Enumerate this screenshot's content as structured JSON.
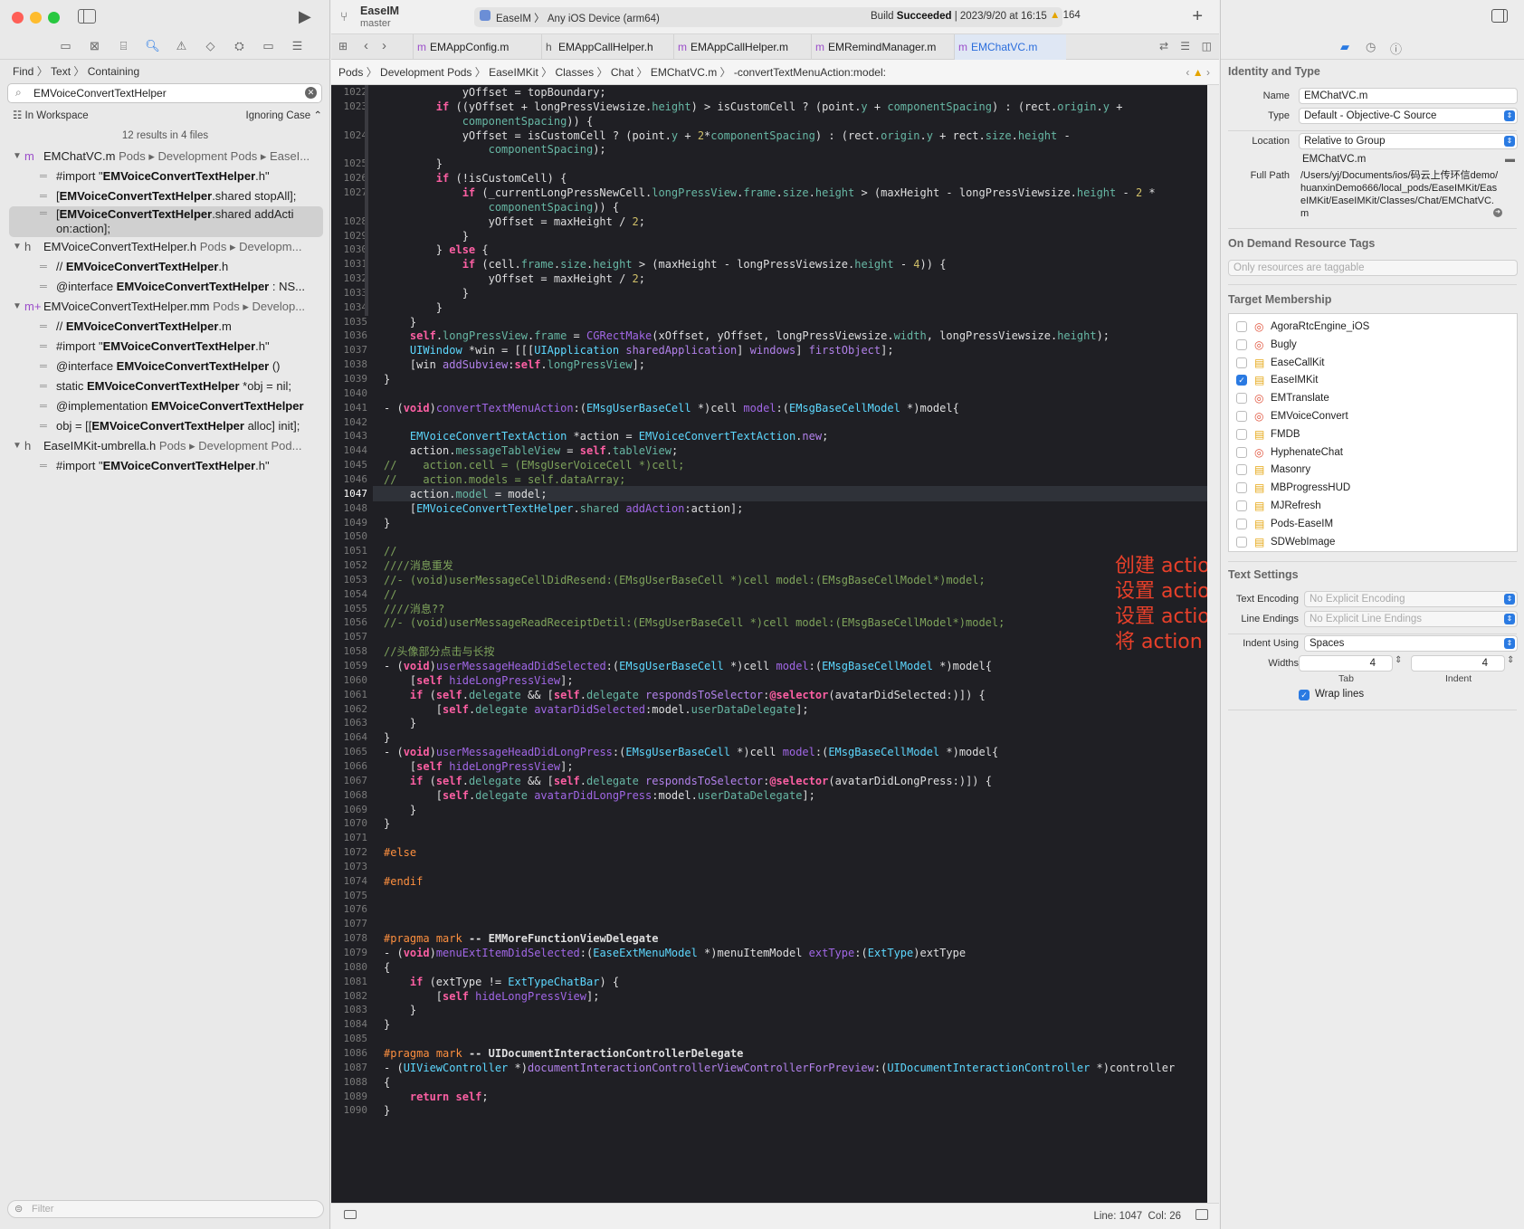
{
  "window": {
    "scheme": "EaseIM",
    "branch": "master",
    "run_destination": "EaseIM 〉 Any iOS Device (arm64)",
    "build_status_prefix": "Build ",
    "build_status": "Succeeded",
    "build_time": " | 2023/9/20 at 16:15",
    "warnings": "164",
    "colors": {
      "close": "#ff5f57",
      "minimize": "#febc2e",
      "zoom": "#28c840",
      "accent": "#2a7ae2"
    }
  },
  "navigator": {
    "find_mode": [
      "Find",
      "〉",
      "Text",
      "〉",
      "Containing"
    ],
    "search_query": "EMVoiceConvertTextHelper",
    "scope": "In Workspace",
    "case_mode": "Ignoring Case",
    "result_count": "12 results in 4 files",
    "files": [
      {
        "icon": "m",
        "name": "EMChatVC.m",
        "path": " Pods ▸ Development Pods ▸ EaseI...",
        "matches": [
          {
            "pre": "#import \"",
            "bold": "EMVoiceConvertTextHelper",
            "post": ".h\""
          },
          {
            "pre": "[",
            "bold": "EMVoiceConvertTextHelper",
            "post": ".shared stopAll];"
          },
          {
            "pre": "[",
            "bold": "EMVoiceConvertTextHelper",
            "post": ".shared addActi on:action];"
          }
        ]
      },
      {
        "icon": "h",
        "name": "EMVoiceConvertTextHelper.h",
        "path": " Pods ▸ Developm...",
        "matches": [
          {
            "pre": "//  ",
            "bold": "EMVoiceConvertTextHelper",
            "post": ".h"
          },
          {
            "pre": "@interface ",
            "bold": "EMVoiceConvertTextHelper",
            "post": " : NS..."
          }
        ]
      },
      {
        "icon": "m+",
        "name": "EMVoiceConvertTextHelper.mm",
        "path": " Pods ▸ Develop...",
        "matches": [
          {
            "pre": "//  ",
            "bold": "EMVoiceConvertTextHelper",
            "post": ".m"
          },
          {
            "pre": "#import \"",
            "bold": "EMVoiceConvertTextHelper",
            "post": ".h\""
          },
          {
            "pre": "@interface ",
            "bold": "EMVoiceConvertTextHelper",
            "post": " ()"
          },
          {
            "pre": "static ",
            "bold": "EMVoiceConvertTextHelper",
            "post": " *obj = nil;"
          },
          {
            "pre": "@implementation ",
            "bold": "EMVoiceConvertTextHelper",
            "post": ""
          },
          {
            "pre": "obj = [[",
            "bold": "EMVoiceConvertTextHelper",
            "post": " alloc] init];"
          }
        ]
      },
      {
        "icon": "h",
        "name": "EaseIMKit-umbrella.h",
        "path": " Pods ▸ Development Pod...",
        "matches": [
          {
            "pre": "#import \"",
            "bold": "EMVoiceConvertTextHelper",
            "post": ".h\""
          }
        ]
      }
    ],
    "filter_placeholder": "Filter"
  },
  "tabs": [
    "EMAppConfig.m",
    "EMAppCallHelper.h",
    "EMAppCallHelper.m",
    "EMRemindManager.m",
    "EMChatVC.m"
  ],
  "tab_icons": [
    "m",
    "h",
    "m",
    "m",
    "m"
  ],
  "jumpbar": [
    "Pods",
    "Development Pods",
    "EaseIMKit",
    "Classes",
    "Chat",
    "EMChatVC.m",
    "-convertTextMenuAction:model:"
  ],
  "editor": {
    "current_line": "1047",
    "lines": [
      {
        "n": "1022",
        "h": "            yOffset = topBoundary;"
      },
      {
        "n": "1023",
        "h": "        <k>if</k> ((yOffset + longPressViewsize.<p>height</p>) > isCustomCell ? (point.<p>y</p> + <p>componentSpacing</p>) : (rect.<p>origin</p>.<p>y</p> +"
      },
      {
        "n": "",
        "h": "            <p>componentSpacing</p>)) {"
      },
      {
        "n": "1024",
        "h": "            yOffset = isCustomCell ? (point.<p>y</p> + <u>2</u>*<p>componentSpacing</p>) : (rect.<p>origin</p>.<p>y</p> + rect.<p>size</p>.<p>height</p> -"
      },
      {
        "n": "",
        "h": "                <p>componentSpacing</p>);"
      },
      {
        "n": "1025",
        "h": "        }"
      },
      {
        "n": "1026",
        "h": "        <k>if</k> (!isCustomCell) {"
      },
      {
        "n": "1027",
        "h": "            <k>if</k> (_currentLongPressNewCell.<p>longPressView</p>.<p>frame</p>.<p>size</p>.<p>height</p> > (maxHeight - longPressViewsize.<p>height</p> - <u>2</u> *"
      },
      {
        "n": "",
        "h": "                <p>componentSpacing</p>)) {"
      },
      {
        "n": "1028",
        "h": "                yOffset = maxHeight / <u>2</u>;"
      },
      {
        "n": "1029",
        "h": "            }"
      },
      {
        "n": "1030",
        "h": "        } <k>else</k> {"
      },
      {
        "n": "1031",
        "h": "            <k>if</k> (cell.<p>frame</p>.<p>size</p>.<p>height</p> > (maxHeight - longPressViewsize.<p>height</p> - <u>4</u>)) {"
      },
      {
        "n": "1032",
        "h": "                yOffset = maxHeight / <u>2</u>;"
      },
      {
        "n": "1033",
        "h": "            }"
      },
      {
        "n": "1034",
        "h": "        }"
      },
      {
        "n": "1035",
        "h": "    }"
      },
      {
        "n": "1036",
        "h": "    <k>self</k>.<p>longPressView</p>.<p>frame</p> = <f>CGRectMake</f>(xOffset, yOffset, longPressViewsize.<p>width</p>, longPressViewsize.<p>height</p>);"
      },
      {
        "n": "1037",
        "h": "    <t>UIWindow</t> *win = [[[<t>UIApplication</t> <e>sharedApplication</e>] <e>windows</e>] <e>firstObject</e>];"
      },
      {
        "n": "1038",
        "h": "    [win <e>addSubview</e>:<k>self</k>.<p>longPressView</p>];"
      },
      {
        "n": "1039",
        "h": "}"
      },
      {
        "n": "1040",
        "h": ""
      },
      {
        "n": "1041",
        "h": "- (<k>void</k>)<f>convertTextMenuAction</f>:(<t>EMsgUserBaseCell</t> *)cell <f>model</f>:(<t>EMsgBaseCellModel</t> *)model{"
      },
      {
        "n": "1042",
        "h": ""
      },
      {
        "n": "1043",
        "h": "    <t>EMVoiceConvertTextAction</t> *action = <t>EMVoiceConvertTextAction</t>.<e>new</e>;"
      },
      {
        "n": "1044",
        "h": "    action.<p>messageTableView</p> = <k>self</k>.<p>tableView</p>;"
      },
      {
        "n": "1045",
        "h": "<c>//    action.cell = (EMsgUserVoiceCell *)cell;</c>"
      },
      {
        "n": "1046",
        "h": "<c>//    action.models = self.dataArray;</c>"
      },
      {
        "n": "1047",
        "h": "    action.<p>model</p> = model;"
      },
      {
        "n": "1048",
        "h": "    [<t>EMVoiceConvertTextHelper</t>.<p>shared</p> <f>addAction</f>:action];"
      },
      {
        "n": "1049",
        "h": "}"
      },
      {
        "n": "1050",
        "h": ""
      },
      {
        "n": "1051",
        "h": "<c>//</c>"
      },
      {
        "n": "1052",
        "h": "<c>////消息重发</c>"
      },
      {
        "n": "1053",
        "h": "<c>//- (void)userMessageCellDidResend:(EMsgUserBaseCell *)cell model:(EMsgBaseCellModel*)model;</c>"
      },
      {
        "n": "1054",
        "h": "<c>//</c>"
      },
      {
        "n": "1055",
        "h": "<c>////消息??</c>"
      },
      {
        "n": "1056",
        "h": "<c>//- (void)userMessageReadReceiptDetil:(EMsgUserBaseCell *)cell model:(EMsgBaseCellModel*)model;</c>"
      },
      {
        "n": "1057",
        "h": ""
      },
      {
        "n": "1058",
        "h": "<c>//头像部分点击与长按</c>"
      },
      {
        "n": "1059",
        "h": "- (<k>void</k>)<f>userMessageHeadDidSelected</f>:(<t>EMsgUserBaseCell</t> *)cell <f>model</f>:(<t>EMsgBaseCellModel</t> *)model{"
      },
      {
        "n": "1060",
        "h": "    [<k>self</k> <f>hideLongPressView</f>];"
      },
      {
        "n": "1061",
        "h": "    <k>if</k> (<k>self</k>.<p>delegate</p> && [<k>self</k>.<p>delegate</p> <e>respondsToSelector</e>:<k>@selector</k>(avatarDidSelected:)]) {"
      },
      {
        "n": "1062",
        "h": "        [<k>self</k>.<p>delegate</p> <f>avatarDidSelected</f>:model.<p>userDataDelegate</p>];"
      },
      {
        "n": "1063",
        "h": "    }"
      },
      {
        "n": "1064",
        "h": "}"
      },
      {
        "n": "1065",
        "h": "- (<k>void</k>)<f>userMessageHeadDidLongPress</f>:(<t>EMsgUserBaseCell</t> *)cell <f>model</f>:(<t>EMsgBaseCellModel</t> *)model{"
      },
      {
        "n": "1066",
        "h": "    [<k>self</k> <f>hideLongPressView</f>];"
      },
      {
        "n": "1067",
        "h": "    <k>if</k> (<k>self</k>.<p>delegate</p> && [<k>self</k>.<p>delegate</p> <e>respondsToSelector</e>:<k>@selector</k>(avatarDidLongPress:)]) {"
      },
      {
        "n": "1068",
        "h": "        [<k>self</k>.<p>delegate</p> <f>avatarDidLongPress</f>:model.<p>userDataDelegate</p>];"
      },
      {
        "n": "1069",
        "h": "    }"
      },
      {
        "n": "1070",
        "h": "}"
      },
      {
        "n": "1071",
        "h": ""
      },
      {
        "n": "1072",
        "h": "<o>#else</o>"
      },
      {
        "n": "1073",
        "h": ""
      },
      {
        "n": "1074",
        "h": "<o>#endif</o>"
      },
      {
        "n": "1075",
        "h": ""
      },
      {
        "n": "1076",
        "h": ""
      },
      {
        "n": "1077",
        "h": ""
      },
      {
        "n": "1078",
        "h": "<o>#pragma</o> <o>mark</o> <b>-- EMMoreFunctionViewDelegate</b>"
      },
      {
        "n": "1079",
        "h": "- (<k>void</k>)<f>menuExtItemDidSelected</f>:(<t>EaseExtMenuModel</t> *)menuItemModel <f>extType</f>:(<t>ExtType</t>)extType"
      },
      {
        "n": "1080",
        "h": "{"
      },
      {
        "n": "1081",
        "h": "    <k>if</k> (extType != <t>ExtTypeChatBar</t>) {"
      },
      {
        "n": "1082",
        "h": "        [<k>self</k> <f>hideLongPressView</f>];"
      },
      {
        "n": "1083",
        "h": "    }"
      },
      {
        "n": "1084",
        "h": "}"
      },
      {
        "n": "1085",
        "h": ""
      },
      {
        "n": "1086",
        "h": "<o>#pragma</o> <o>mark</o> <b>-- UIDocumentInteractionControllerDelegate</b>"
      },
      {
        "n": "1087",
        "h": "- (<t>UIViewController</t> *)<e>documentInteractionControllerViewControllerForPreview</e>:(<t>UIDocumentInteractionController</t> *)controller"
      },
      {
        "n": "1088",
        "h": "{"
      },
      {
        "n": "1089",
        "h": "    <k>return</k> <k>self</k>;"
      },
      {
        "n": "1090",
        "h": "}"
      }
    ],
    "annotation": [
      "创建 action",
      "设置 action 的 tableview(刷新用)",
      "设置 action 的 model(修改 model 内的数据)",
      "将 action 添加到队列中等待执行"
    ],
    "status": "Line: 1047  Col: 26"
  },
  "inspector": {
    "section_identity": "Identity and Type",
    "name_label": "Name",
    "name_value": "EMChatVC.m",
    "type_label": "Type",
    "type_value": "Default - Objective-C Source",
    "location_label": "Location",
    "location_value": "Relative to Group",
    "location_file": "EMChatVC.m",
    "fullpath_label": "Full Path",
    "fullpath_value": "/Users/yj/Documents/ios/码云上传环信demo/huanxinDemo666/local_pods/EaseIMKit/EaseIMKit/EaseIMKit/Classes/Chat/EMChatVC.m",
    "section_odr": "On Demand Resource Tags",
    "odr_placeholder": "Only resources are taggable",
    "section_target": "Target Membership",
    "targets": [
      {
        "name": "AgoraRtcEngine_iOS",
        "icon": "target",
        "checked": false
      },
      {
        "name": "Bugly",
        "icon": "target",
        "checked": false
      },
      {
        "name": "EaseCallKit",
        "icon": "framework",
        "checked": false
      },
      {
        "name": "EaseIMKit",
        "icon": "framework",
        "checked": true
      },
      {
        "name": "EMTranslate",
        "icon": "target",
        "checked": false
      },
      {
        "name": "EMVoiceConvert",
        "icon": "target",
        "checked": false
      },
      {
        "name": "FMDB",
        "icon": "framework",
        "checked": false
      },
      {
        "name": "HyphenateChat",
        "icon": "target",
        "checked": false
      },
      {
        "name": "Masonry",
        "icon": "framework",
        "checked": false
      },
      {
        "name": "MBProgressHUD",
        "icon": "framework",
        "checked": false
      },
      {
        "name": "MJRefresh",
        "icon": "framework",
        "checked": false
      },
      {
        "name": "Pods-EaseIM",
        "icon": "framework",
        "checked": false
      },
      {
        "name": "SDWebImage",
        "icon": "framework",
        "checked": false
      }
    ],
    "section_text": "Text Settings",
    "encoding_label": "Text Encoding",
    "encoding_value": "No Explicit Encoding",
    "endings_label": "Line Endings",
    "endings_value": "No Explicit Line Endings",
    "indent_label": "Indent Using",
    "indent_value": "Spaces",
    "widths_label": "Widths",
    "tab_value": "4",
    "indent_width_value": "4",
    "tab_caption": "Tab",
    "indent_caption": "Indent",
    "wrap_label": "Wrap lines"
  }
}
